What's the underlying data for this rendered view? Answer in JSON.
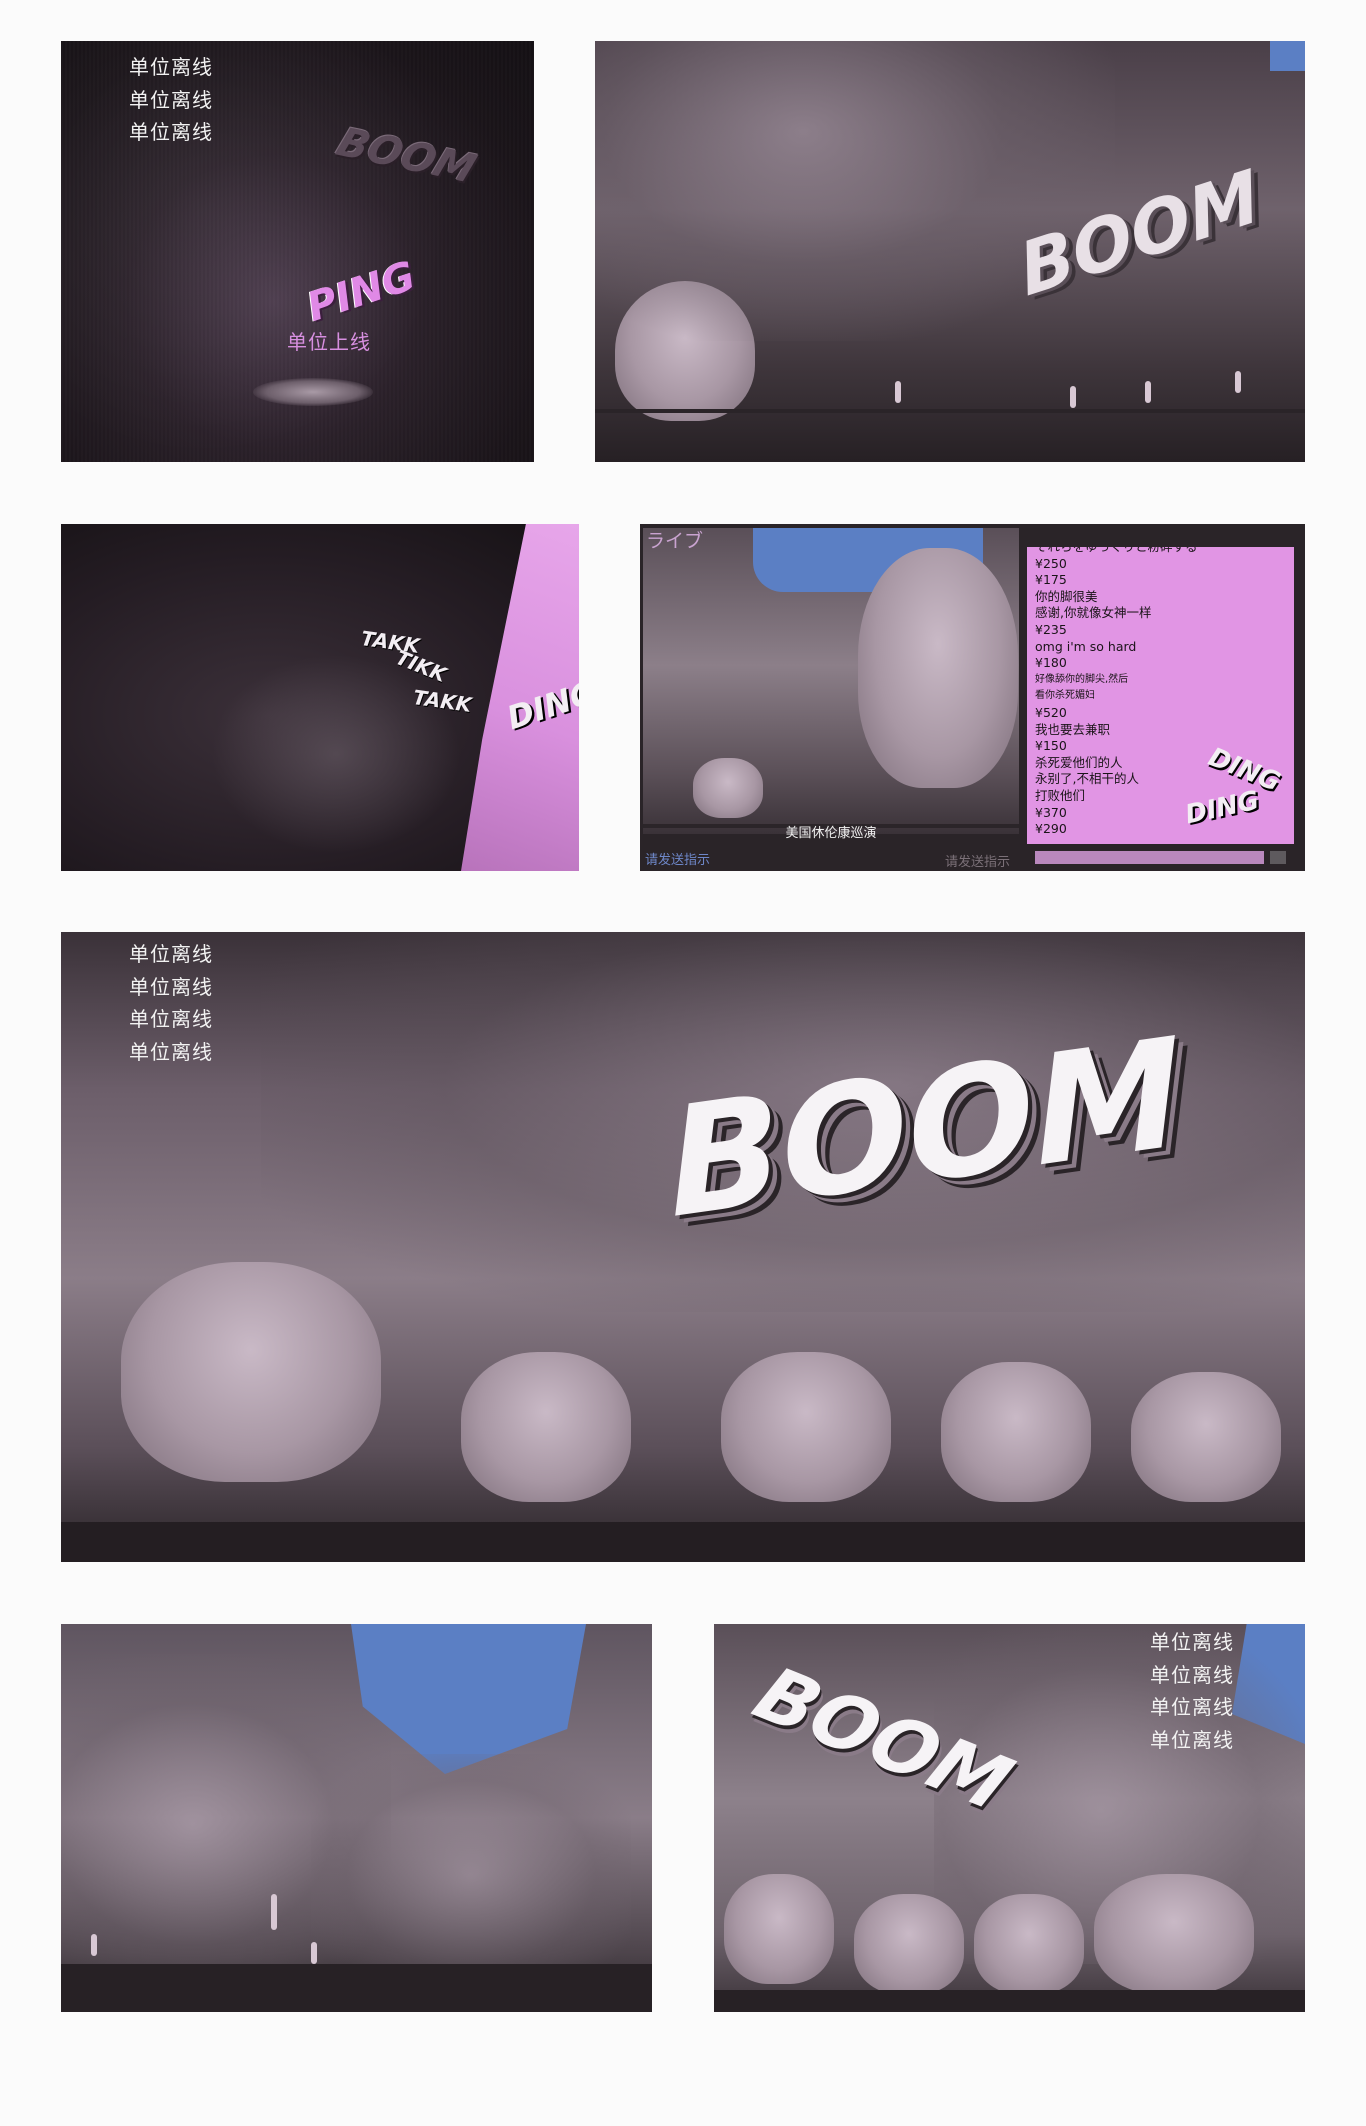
{
  "panel1": {
    "offline_status": [
      "单位离线",
      "单位离线",
      "单位离线"
    ],
    "sfx_boom": "BOOM",
    "sfx_ping": "PING",
    "online_status": "单位上线"
  },
  "panel2": {
    "sfx_boom": "BOOM"
  },
  "panel3": {
    "sfx_takk_1": "TAKK",
    "sfx_tikk": "TIKK",
    "sfx_takk_2": "TAKK",
    "sfx_ding": "DING"
  },
  "panel4": {
    "live_label": "ライブ",
    "video_caption": "美国休伦康巡演",
    "hint_left": "请发送指示",
    "hint_right": "请发送指示",
    "chat_lines": [
      "それらをゆっくりと粉砕する",
      "¥250",
      "¥175",
      "你的脚很美",
      "感谢,你就像女神一样",
      "¥235",
      "omg i'm so hard",
      "¥180",
      "好像舔你的脚尖,然后",
      "看你杀死媚妇",
      "¥520",
      "我也要去兼职",
      "¥150",
      "杀死爱他们的人",
      "永别了,不相干的人",
      "打败他们",
      "¥370",
      "¥290"
    ],
    "sfx_ding_1": "DING",
    "sfx_ding_2": "DING"
  },
  "panel5": {
    "offline_status": [
      "单位离线",
      "单位离线",
      "单位离线",
      "单位离线"
    ],
    "sfx_boom": "BOOM"
  },
  "panel7": {
    "offline_status": [
      "单位离线",
      "单位离线",
      "单位离线",
      "单位离线"
    ],
    "sfx_boom": "BOOM"
  },
  "colors": {
    "accent_pink": "#e195e4",
    "sleeve_blue": "#5b7fc4",
    "sfx_pink": "#e089e6",
    "sfx_white": "#f3eef3"
  }
}
